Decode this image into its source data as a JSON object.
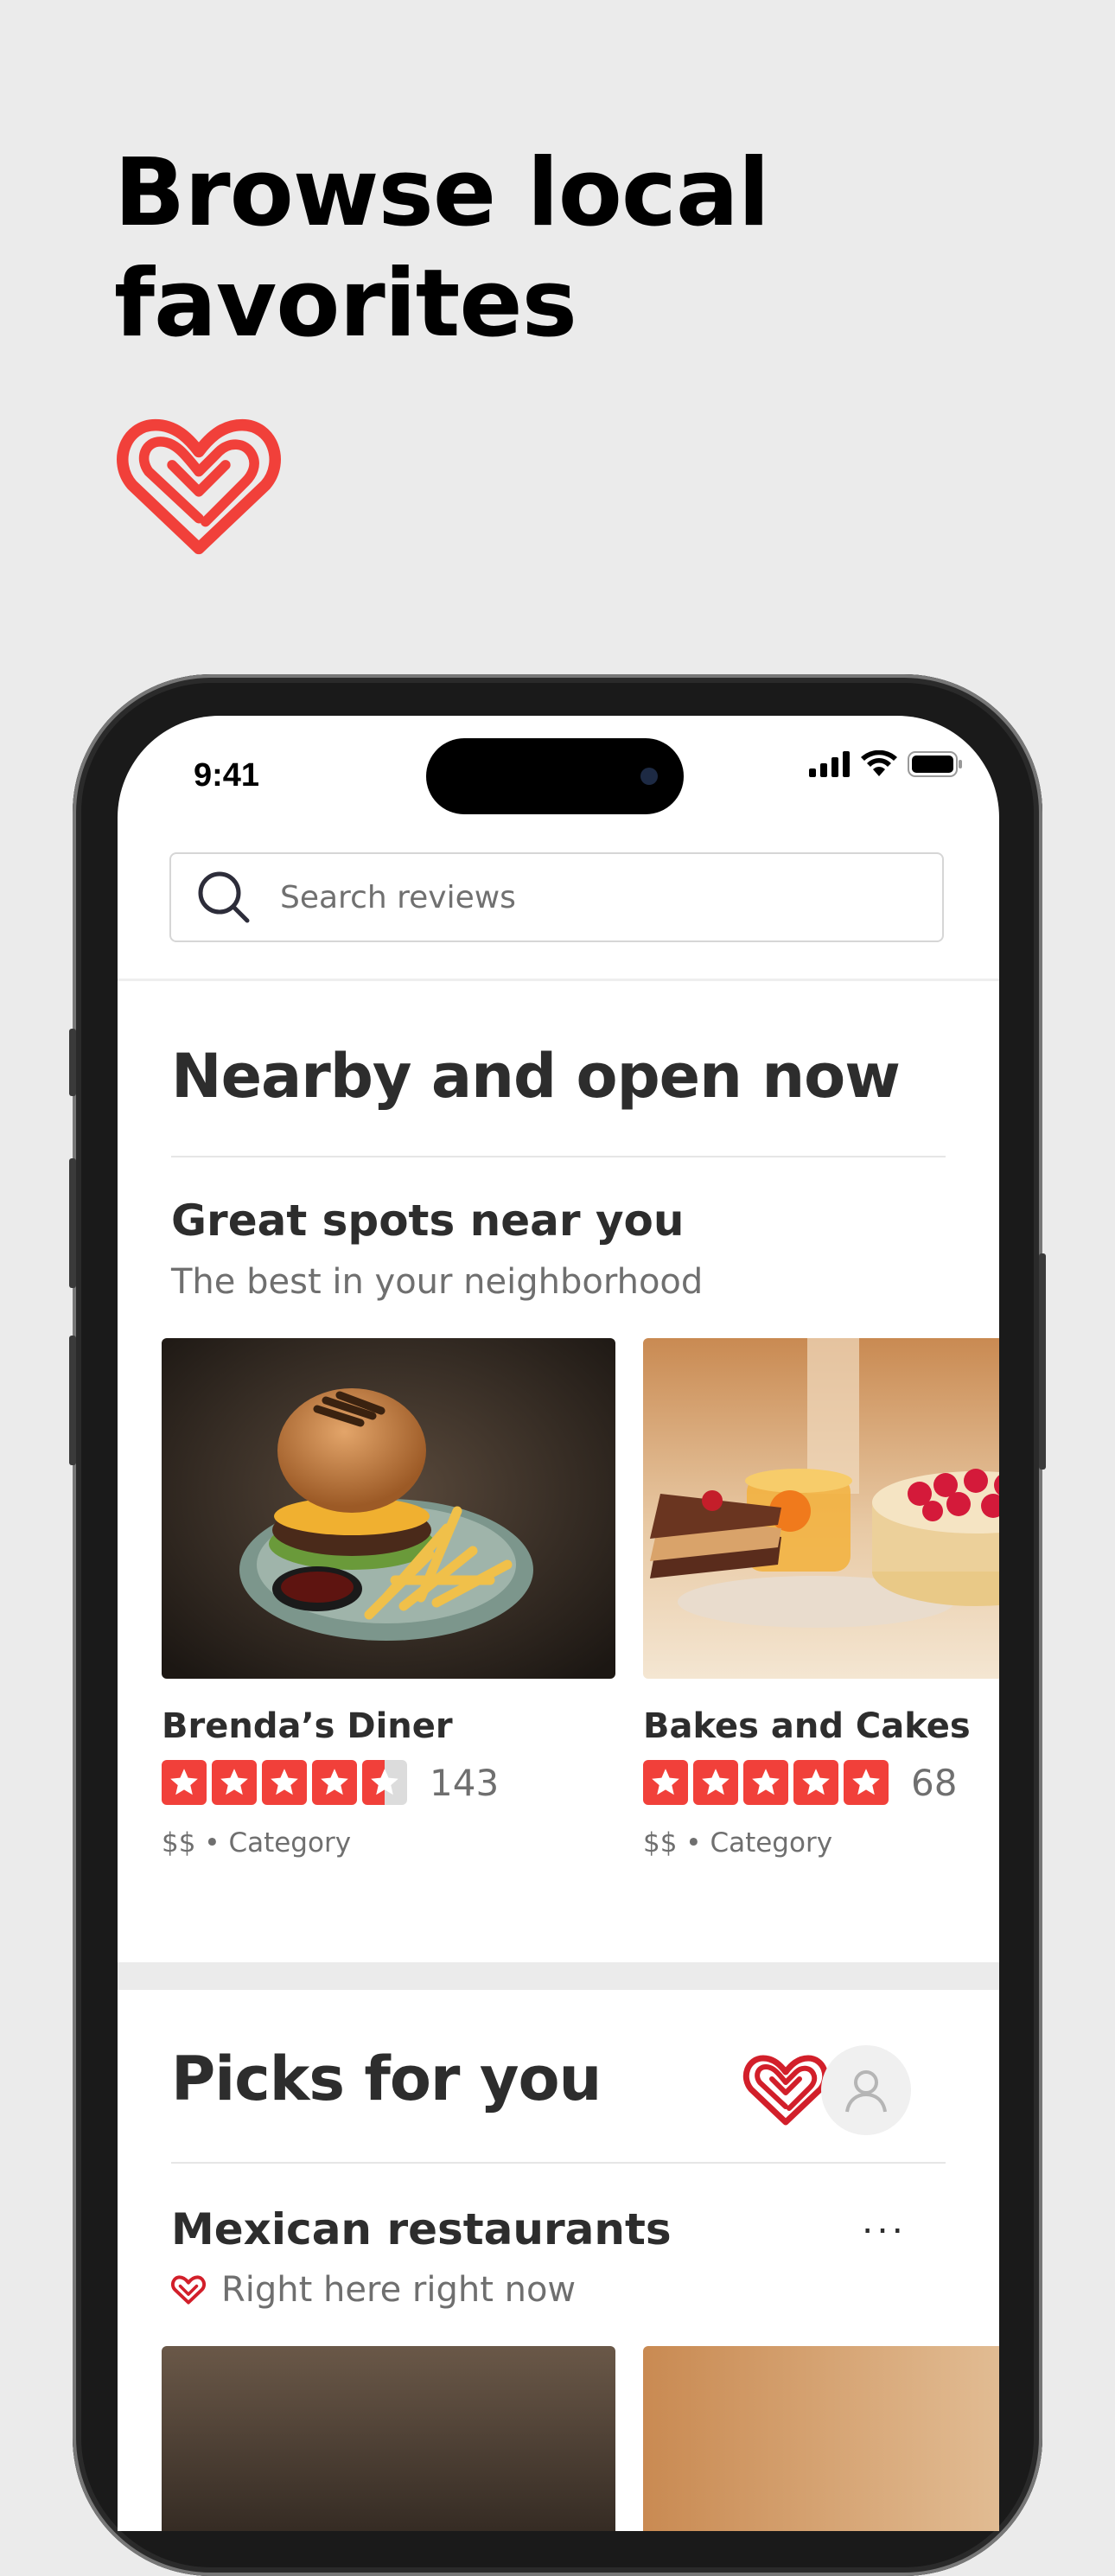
{
  "promo": {
    "title_line1": "Browse local",
    "title_line2": "favorites"
  },
  "colors": {
    "brand_red": "#f1403a",
    "star_red": "#f1403a",
    "star_empty": "#dcdcdc",
    "text_dark": "#2d2d2d",
    "text_muted": "#6f6f6f",
    "background": "#ebebeb"
  },
  "status_bar": {
    "time": "9:41",
    "icons": [
      "signal-icon",
      "wifi-icon",
      "battery-icon"
    ]
  },
  "search": {
    "placeholder": "Search reviews",
    "icon": "search-icon"
  },
  "nearby": {
    "section_title": "Nearby and open now",
    "subsection_title": "Great spots near you",
    "subsection_caption": "The best in your neighborhood",
    "cards": [
      {
        "name": "Brenda’s Diner",
        "rating": 4.5,
        "review_count": "143",
        "meta": "$$ • Category",
        "image": "burger-and-fries-photo"
      },
      {
        "name": "Bakes and Cakes",
        "rating": 5,
        "review_count": "68",
        "meta": "$$ • Category",
        "image": "cakes-and-tea-photo"
      }
    ]
  },
  "picks": {
    "section_title": "Picks for you",
    "subsection_title": "Mexican restaurants",
    "subsection_caption": "Right here right now",
    "more_label": "···",
    "icons": [
      "heart-logo-icon",
      "user-avatar-icon",
      "more-icon"
    ]
  }
}
